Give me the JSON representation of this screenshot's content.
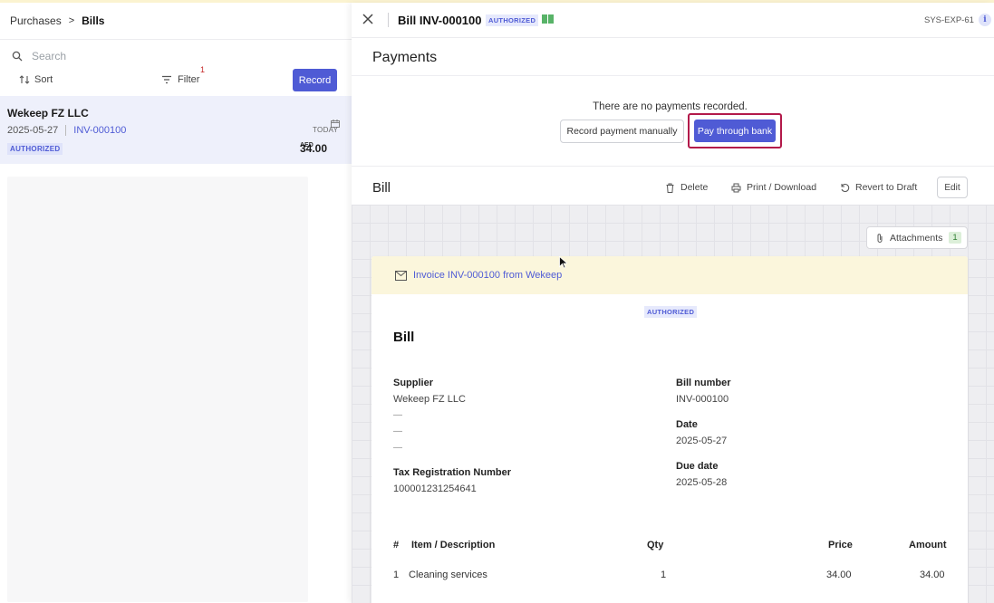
{
  "breadcrumb": {
    "parent": "Purchases",
    "separator": ">",
    "current": "Bills"
  },
  "search": {
    "placeholder": "Search"
  },
  "list_toolbar": {
    "sort_label": "Sort",
    "filter_label": "Filter",
    "filter_count": "1",
    "record_label": "Record"
  },
  "bill_list": [
    {
      "supplier": "Wekeep FZ LLC",
      "date": "2025-05-27",
      "number": "INV-000100",
      "status": "AUTHORIZED",
      "due": "TODAY",
      "currency": "AED",
      "amount": "34.00"
    }
  ],
  "detail_header": {
    "title": "Bill INV-000100",
    "status": "AUTHORIZED",
    "code": "SYS-EXP-61",
    "info_symbol": "i"
  },
  "payments": {
    "title": "Payments",
    "empty_text": "There are no payments recorded.",
    "manual_label": "Record payment manually",
    "bank_label": "Pay through bank"
  },
  "bill_section": {
    "title": "Bill",
    "delete_label": "Delete",
    "print_label": "Print / Download",
    "revert_label": "Revert to Draft",
    "edit_label": "Edit"
  },
  "attachments": {
    "label": "Attachments",
    "count": "1"
  },
  "document": {
    "banner": "Invoice INV-000100 from Wekeep",
    "status": "AUTHORIZED",
    "title": "Bill",
    "supplier_label": "Supplier",
    "supplier_name": "Wekeep FZ LLC",
    "supplier_lines": [
      "—",
      "—",
      "—"
    ],
    "trn_label": "Tax Registration Number",
    "trn_value": "100001231254641",
    "bill_number_label": "Bill number",
    "bill_number": "INV-000100",
    "date_label": "Date",
    "date": "2025-05-27",
    "due_label": "Due date",
    "due": "2025-05-28",
    "table": {
      "headers": {
        "num": "#",
        "item": "Item / Description",
        "qty": "Qty",
        "price": "Price",
        "amount": "Amount"
      },
      "rows": [
        {
          "num": "1",
          "item": "Cleaning services",
          "qty": "1",
          "price": "34.00",
          "amount": "34.00"
        }
      ]
    }
  },
  "colors": {
    "accent": "#4f5bd5",
    "highlight_border": "#b3194a",
    "banner_bg": "#fbf6dc",
    "selected_row_bg": "#eef0fb"
  }
}
